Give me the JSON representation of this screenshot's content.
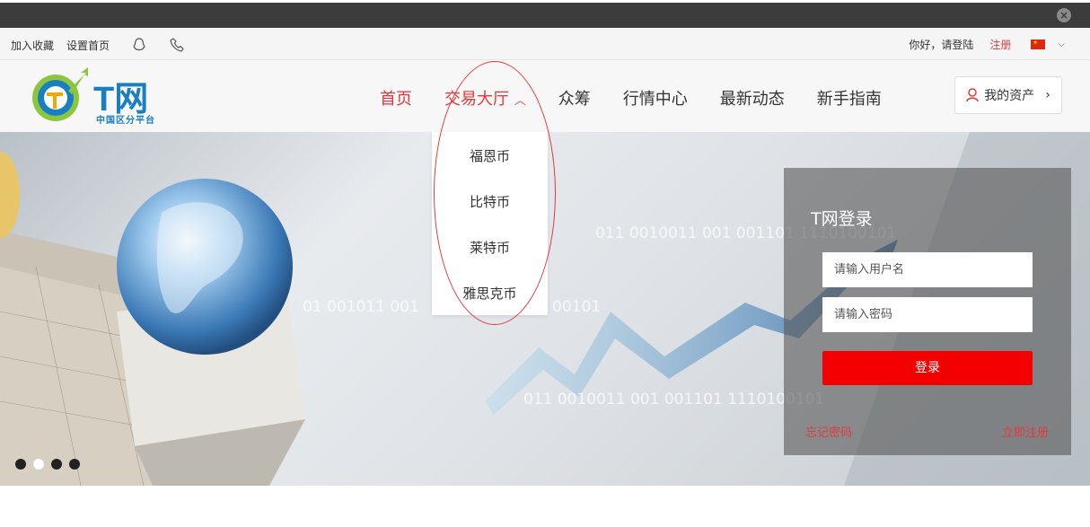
{
  "utility_bar": {
    "bookmark": "加入收藏",
    "set_home": "设置首页",
    "greeting": "你好，请登陆",
    "register": "注册"
  },
  "header": {
    "logo_text": "T网",
    "logo_sub": "中国区分平台",
    "nav": [
      "首页",
      "交易大厅",
      "众筹",
      "行情中心",
      "最新动态",
      "新手指南"
    ],
    "nav_dropdown_arrow": "^",
    "asset_button": "我的资产"
  },
  "dropdown": {
    "items": [
      "福恩币",
      "比特币",
      "莱特币",
      "雅思克币"
    ]
  },
  "hero": {
    "binary_1": "011 0010011 001 001101 1110100101",
    "binary_2": "01 001011 001",
    "binary_3": "00101",
    "binary_4": "011 0010011 001 001101 1110100101"
  },
  "login": {
    "title": "T网登录",
    "username_placeholder": "请输入用户名",
    "password_placeholder": "请输入密码",
    "submit": "登录",
    "forgot": "忘记密码",
    "signup": "立即注册"
  },
  "carousel": {
    "total": 4,
    "active_index": 1
  },
  "colors": {
    "accent": "#e4393c",
    "login_button": "#f40000",
    "brand_blue": "#1a7fc1"
  }
}
